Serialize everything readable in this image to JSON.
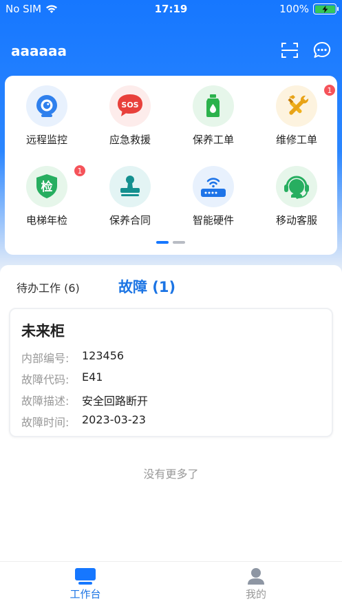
{
  "status_bar": {
    "carrier": "No SIM",
    "time": "17:19",
    "battery": "100%"
  },
  "header": {
    "title": "aaaaaa",
    "icons": [
      "scan-icon",
      "chat-icon"
    ]
  },
  "grid": {
    "items": [
      {
        "label": "远程监控",
        "icon": "camera-icon",
        "badge": ""
      },
      {
        "label": "应急救援",
        "icon": "sos-icon",
        "badge": ""
      },
      {
        "label": "保养工单",
        "icon": "oil-bottle-icon",
        "badge": ""
      },
      {
        "label": "维修工单",
        "icon": "tools-icon",
        "badge": "1"
      },
      {
        "label": "电梯年检",
        "icon": "inspection-shield-icon",
        "badge": "1"
      },
      {
        "label": "保养合同",
        "icon": "stamp-icon",
        "badge": ""
      },
      {
        "label": "智能硬件",
        "icon": "router-icon",
        "badge": ""
      },
      {
        "label": "移动客服",
        "icon": "headset-icon",
        "badge": ""
      }
    ],
    "sos_text": "SOS",
    "inspection_text": "检",
    "page_count": 2,
    "active_page": 0
  },
  "tabs": {
    "pending": "待办工作 (6)",
    "fault": "故障 (1)"
  },
  "fault_card": {
    "name": "未来柜",
    "rows": [
      {
        "key": "内部编号:",
        "value": "123456"
      },
      {
        "key": "故障代码:",
        "value": "E41"
      },
      {
        "key": "故障描述:",
        "value": "安全回路断开"
      },
      {
        "key": "故障时间:",
        "value": "2023-03-23"
      }
    ]
  },
  "no_more": "没有更多了",
  "tabbar": {
    "items": [
      {
        "label": "工作台",
        "icon": "workbench-icon",
        "active": true
      },
      {
        "label": "我的",
        "icon": "profile-icon",
        "active": false
      }
    ]
  },
  "colors": {
    "primary": "#1677ff",
    "active_text": "#1b74e4",
    "inactive": "#999999",
    "badge": "#f5535a"
  }
}
